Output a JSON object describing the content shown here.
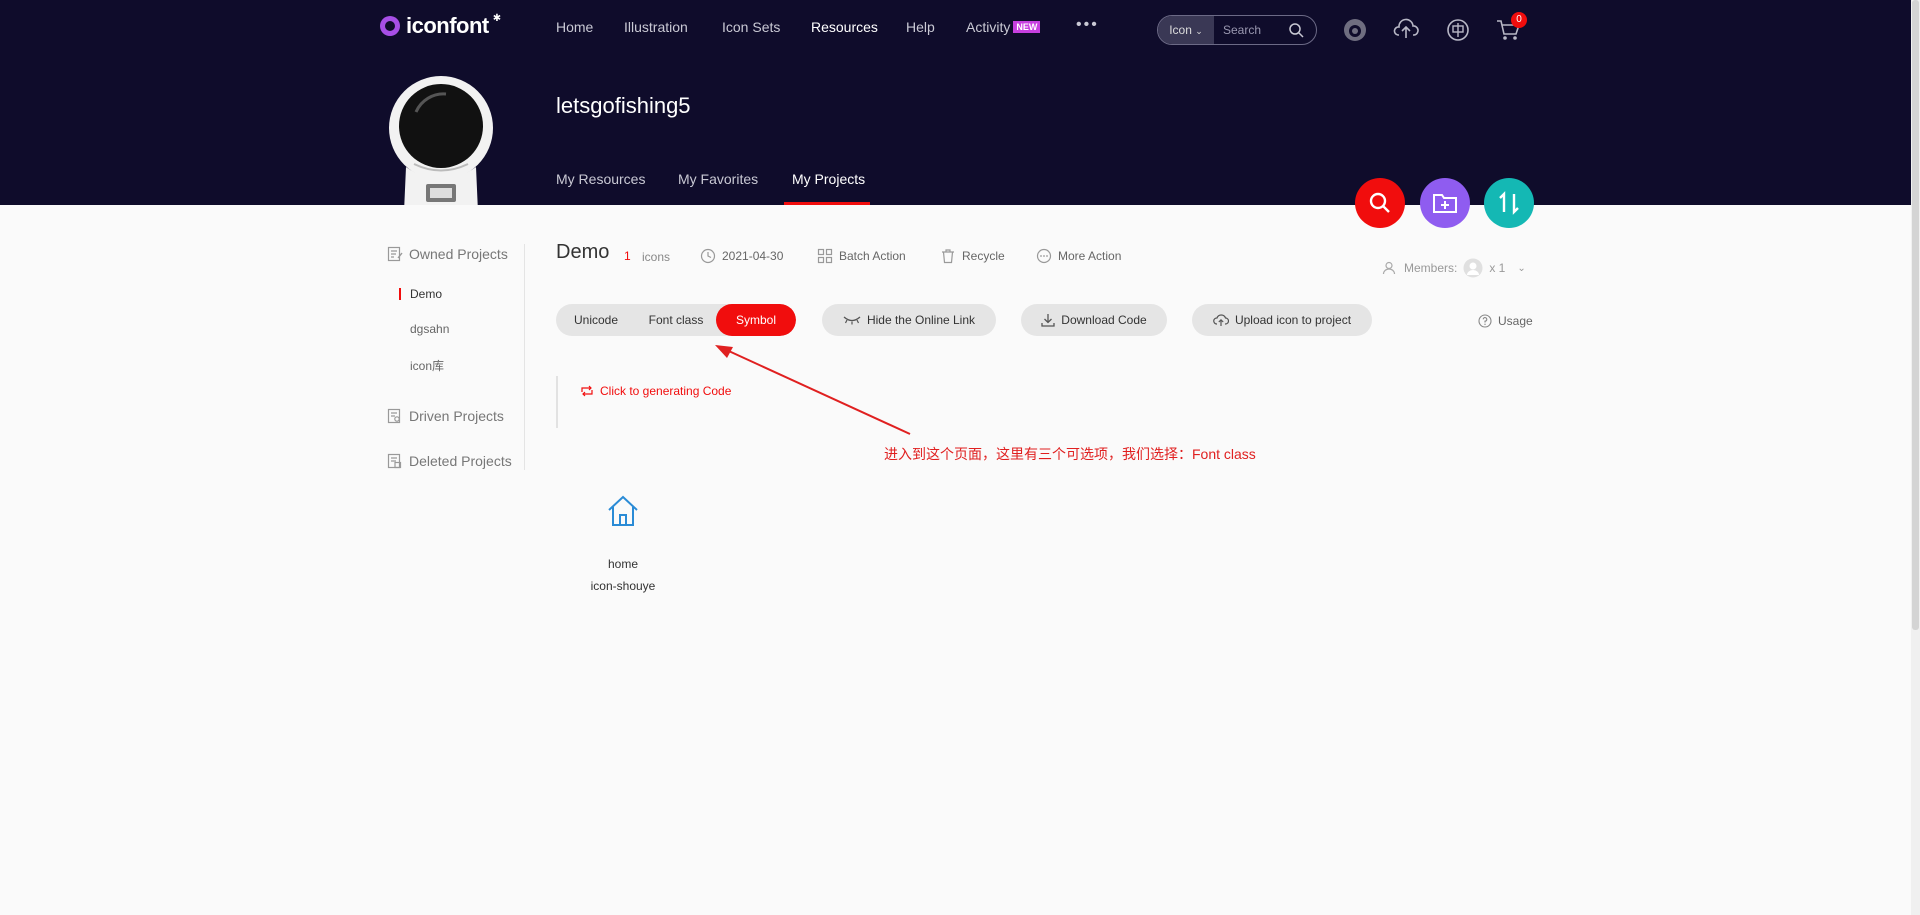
{
  "header": {
    "logo_text": "iconfont",
    "nav": [
      {
        "label": "Home"
      },
      {
        "label": "Illustration"
      },
      {
        "label": "Icon Sets"
      },
      {
        "label": "Resources"
      },
      {
        "label": "Help"
      },
      {
        "label": "Activity"
      }
    ],
    "new_badge": "NEW",
    "search": {
      "type": "Icon",
      "placeholder": "Search"
    },
    "cart_count": "0"
  },
  "profile": {
    "username": "letsgofishing5",
    "tabs": [
      {
        "label": "My Resources"
      },
      {
        "label": "My Favorites"
      },
      {
        "label": "My Projects"
      }
    ]
  },
  "sidebar": {
    "owned_label": "Owned Projects",
    "projects": [
      {
        "label": "Demo"
      },
      {
        "label": "dgsahn"
      },
      {
        "label": "icon库"
      }
    ],
    "driven_label": "Driven Projects",
    "deleted_label": "Deleted Projects"
  },
  "project": {
    "name": "Demo",
    "icon_count": "1",
    "icon_count_label": "icons",
    "date": "2021-04-30",
    "batch_label": "Batch Action",
    "recycle_label": "Recycle",
    "more_label": "More Action",
    "members_label": "Members:",
    "members_count": "x 1"
  },
  "toolbar": {
    "modes": [
      {
        "label": "Unicode"
      },
      {
        "label": "Font class"
      },
      {
        "label": "Symbol"
      }
    ],
    "hide_link_label": "Hide the Online Link",
    "download_label": "Download Code",
    "upload_label": "Upload icon to project",
    "usage_label": "Usage"
  },
  "code_panel": {
    "generate_label": "Click to generating Code"
  },
  "annotation": {
    "text": "进入到这个页面，这里有三个可选项，我们选择：Font class"
  },
  "icons": [
    {
      "name": "home",
      "class": "icon-shouye"
    }
  ],
  "colors": {
    "accent": "#f10d0d",
    "header_bg": "#0f0c2b",
    "fab_search": "#f10d0d",
    "fab_folder": "#8f5cf0",
    "fab_sort": "#14b8b4",
    "icon_blue": "#2a8bd6"
  }
}
